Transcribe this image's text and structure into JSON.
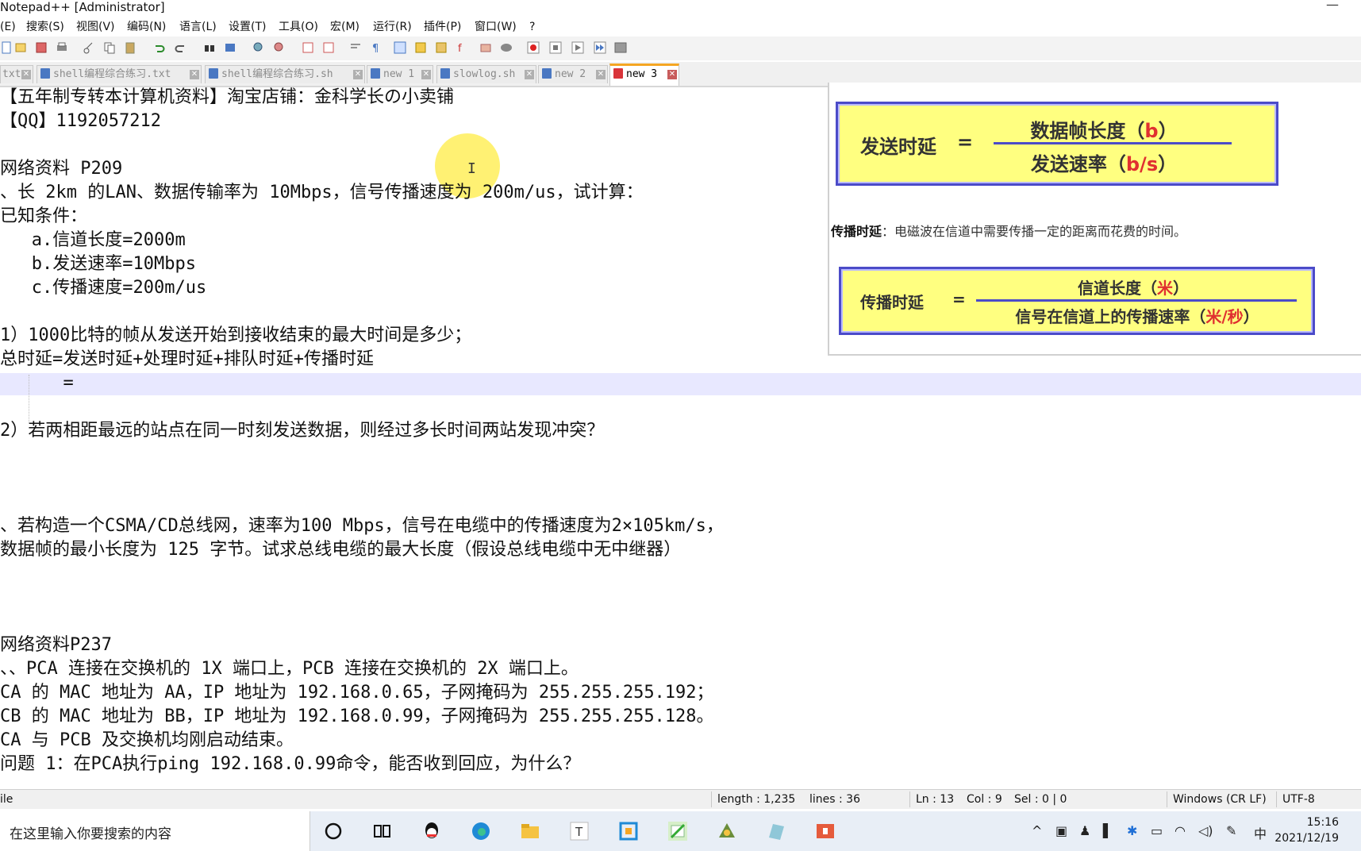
{
  "window": {
    "title": "Notepad++ [Administrator]"
  },
  "menu": [
    "(E)",
    "搜索(S)",
    "视图(V)",
    "编码(N)",
    "语言(L)",
    "设置(T)",
    "工具(O)",
    "宏(M)",
    "运行(R)",
    "插件(P)",
    "窗口(W)",
    "?"
  ],
  "tabs": [
    {
      "label": "txt"
    },
    {
      "label": "shell编程综合练习.txt"
    },
    {
      "label": "shell编程综合练习.sh"
    },
    {
      "label": "new 1"
    },
    {
      "label": "slowlog.sh"
    },
    {
      "label": "new 2"
    },
    {
      "label": "new 3",
      "active": true
    }
  ],
  "editor": {
    "lines": [
      "【五年制专转本计算机资料】淘宝店铺：金科学长の小卖铺",
      "【QQ】1192057212",
      "",
      "网络资料 P209",
      "、长 2km 的LAN、数据传输率为 10Mbps，信号传播速度为 200m/us，试计算：",
      "已知条件：",
      "   a.信道长度=2000m",
      "   b.发送速率=10Mbps",
      "   c.传播速度=200m/us",
      "",
      "1）1000比特的帧从发送开始到接收结束的最大时间是多少；",
      "总时延=发送时延+处理时延+排队时延+传播时延",
      "      =",
      "",
      "2）若两相距最远的站点在同一时刻发送数据，则经过多长时间两站发现冲突？",
      "",
      "",
      "",
      "、若构造一个CSMA/CD总线网，速率为100 Mbps，信号在电缆中的传播速度为2×105km/s，",
      "数据帧的最小长度为 125 字节。试求总线电缆的最大长度（假设总线电缆中无中继器）",
      "",
      "",
      "",
      "网络资料P237",
      "、、PCA 连接在交换机的 1X 端口上，PCB 连接在交换机的 2X 端口上。",
      "CA 的 MAC 地址为 AA，IP 地址为 192.168.0.65，子网掩码为 255.255.255.192；",
      "CB 的 MAC 地址为 BB，IP 地址为 192.168.0.99，子网掩码为 255.255.255.128。",
      "CA 与 PCB 及交换机均刚启动结束。",
      "问题 1：在PCA执行ping 192.168.0.99命令，能否收到回应，为什么？"
    ]
  },
  "overlay": {
    "formula1": {
      "lhs": "发送时延",
      "eq": "=",
      "num": "数据帧长度（",
      "num_unit": "b",
      "num_end": "）",
      "den": "发送速率（",
      "den_unit": "b/s",
      "den_end": "）"
    },
    "prop_label": "传播时延",
    "prop_desc": "：电磁波在信道中需要传播一定的距离而花费的时间。",
    "formula2": {
      "lhs": "传播时延",
      "eq": "=",
      "num": "信道长度（",
      "num_unit": "米",
      "num_end": "）",
      "den": "信号在信道上的传播速率（",
      "den_unit": "米/秒",
      "den_end": "）"
    }
  },
  "status": {
    "filetype": "ile",
    "length": "length : 1,235",
    "lines": "lines : 36",
    "ln": "Ln : 13",
    "col": "Col : 9",
    "sel": "Sel : 0 | 0",
    "eol": "Windows (CR LF)",
    "encoding": "UTF-8"
  },
  "taskbar": {
    "search_placeholder": "在这里输入你要搜索的内容",
    "ime": "中",
    "time": "15:16",
    "date": "2021/12/19"
  },
  "colors": {
    "accent_tab": "#f5a623",
    "formula_bg": "#ffff80",
    "formula_border": "#4b4bc8",
    "red_unit": "#e03030"
  }
}
